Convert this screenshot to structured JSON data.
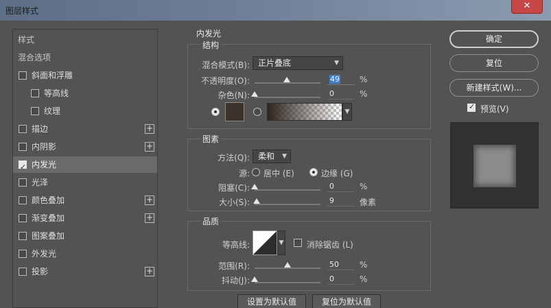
{
  "window": {
    "title": "图层样式",
    "close_label": "✕"
  },
  "stylelist": {
    "items": [
      {
        "label": "样式",
        "type": "header"
      },
      {
        "label": "混合选项",
        "type": "header"
      },
      {
        "label": "斜面和浮雕",
        "checked": false,
        "plus": false,
        "indent": 0
      },
      {
        "label": "等高线",
        "checked": false,
        "plus": false,
        "indent": 1
      },
      {
        "label": "纹理",
        "checked": false,
        "plus": false,
        "indent": 1
      },
      {
        "label": "描边",
        "checked": false,
        "plus": true,
        "indent": 0
      },
      {
        "label": "内阴影",
        "checked": false,
        "plus": true,
        "indent": 0
      },
      {
        "label": "内发光",
        "checked": true,
        "plus": false,
        "indent": 0,
        "active": true
      },
      {
        "label": "光泽",
        "checked": false,
        "plus": false,
        "indent": 0
      },
      {
        "label": "颜色叠加",
        "checked": false,
        "plus": true,
        "indent": 0
      },
      {
        "label": "渐变叠加",
        "checked": false,
        "plus": true,
        "indent": 0
      },
      {
        "label": "图案叠加",
        "checked": false,
        "plus": false,
        "indent": 0
      },
      {
        "label": "外发光",
        "checked": false,
        "plus": false,
        "indent": 0
      },
      {
        "label": "投影",
        "checked": false,
        "plus": true,
        "indent": 0
      }
    ]
  },
  "inner_glow": {
    "title": "内发光",
    "structure": {
      "title": "结构",
      "blend_mode_label": "混合模式(B):",
      "blend_mode_value": "正片叠底",
      "opacity_label": "不透明度(O):",
      "opacity_value": "49",
      "opacity_fraction": 0.49,
      "noise_label": "杂色(N):",
      "noise_value": "0",
      "noise_fraction": 0.0,
      "unit_percent": "%",
      "glow_color": "#3d332b"
    },
    "elements": {
      "title": "图素",
      "technique_label": "方法(Q):",
      "technique_value": "柔和",
      "source_label": "源:",
      "source_center_label": "居中 (E)",
      "source_edge_label": "边缘 (G)",
      "source_selected": "edge",
      "choke_label": "阻塞(C):",
      "choke_value": "0",
      "choke_fraction": 0.0,
      "size_label": "大小(S):",
      "size_value": "9",
      "size_fraction": 0.036,
      "unit_pixels": "像素"
    },
    "quality": {
      "title": "品质",
      "contour_label": "等高线:",
      "antialias_label": "消除锯齿 (L)",
      "antialias_checked": false,
      "range_label": "范围(R):",
      "range_value": "50",
      "range_fraction": 0.5,
      "jitter_label": "抖动(J):",
      "jitter_value": "0",
      "jitter_fraction": 0.0
    },
    "make_default_label": "设置为默认值",
    "reset_default_label": "复位为默认值"
  },
  "actions": {
    "ok_label": "确定",
    "reset_label": "复位",
    "new_style_label": "新建样式(W)...",
    "preview_label": "预览(V)",
    "preview_checked": true
  }
}
